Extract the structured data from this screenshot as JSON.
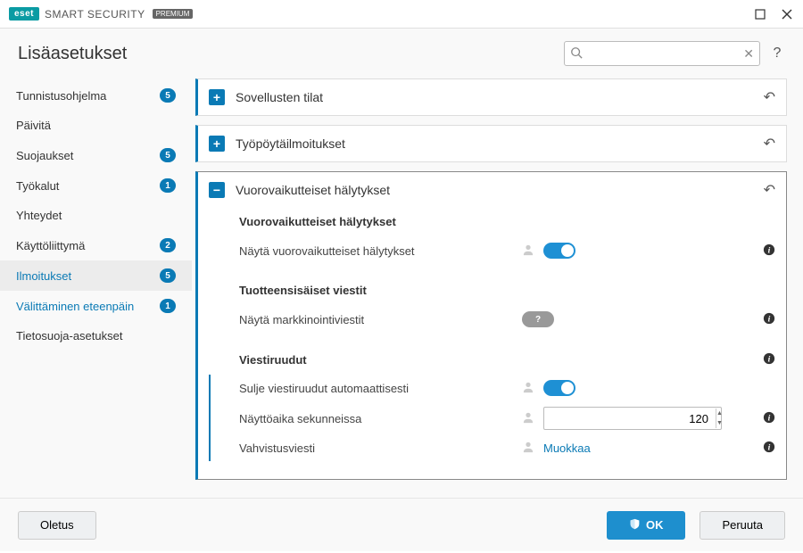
{
  "titlebar": {
    "brand": "eset",
    "product": "SMART SECURITY",
    "edition": "PREMIUM"
  },
  "header": {
    "title": "Lisäasetukset",
    "search_placeholder": ""
  },
  "sidebar": {
    "items": [
      {
        "label": "Tunnistusohjelma",
        "badge": "5"
      },
      {
        "label": "Päivitä",
        "badge": null
      },
      {
        "label": "Suojaukset",
        "badge": "5"
      },
      {
        "label": "Työkalut",
        "badge": "1"
      },
      {
        "label": "Yhteydet",
        "badge": null
      },
      {
        "label": "Käyttöliittymä",
        "badge": "2"
      },
      {
        "label": "Ilmoitukset",
        "badge": "5",
        "selected": true
      },
      {
        "label": "Välittäminen eteenpäin",
        "badge": "1",
        "highlight": true
      },
      {
        "label": "Tietosuoja-asetukset",
        "badge": null
      }
    ]
  },
  "panels": {
    "app_states": {
      "title": "Sovellusten tilat"
    },
    "desktop_notifications": {
      "title": "Työpöytäilmoitukset"
    },
    "interactive_alerts": {
      "title": "Vuorovaikutteiset hälytykset",
      "section1_title": "Vuorovaikutteiset hälytykset",
      "row1_label": "Näytä vuorovaikutteiset hälytykset",
      "section2_title": "Tuotteensisäiset viestit",
      "row2_label": "Näytä markkinointiviestit",
      "section3_title": "Viestiruudut",
      "row3_label": "Sulje viestiruudut automaattisesti",
      "row4_label": "Näyttöaika sekunneissa",
      "row4_value": "120",
      "row5_label": "Vahvistusviesti",
      "row5_link": "Muokkaa"
    }
  },
  "footer": {
    "default_label": "Oletus",
    "ok_label": "OK",
    "cancel_label": "Peruuta"
  }
}
